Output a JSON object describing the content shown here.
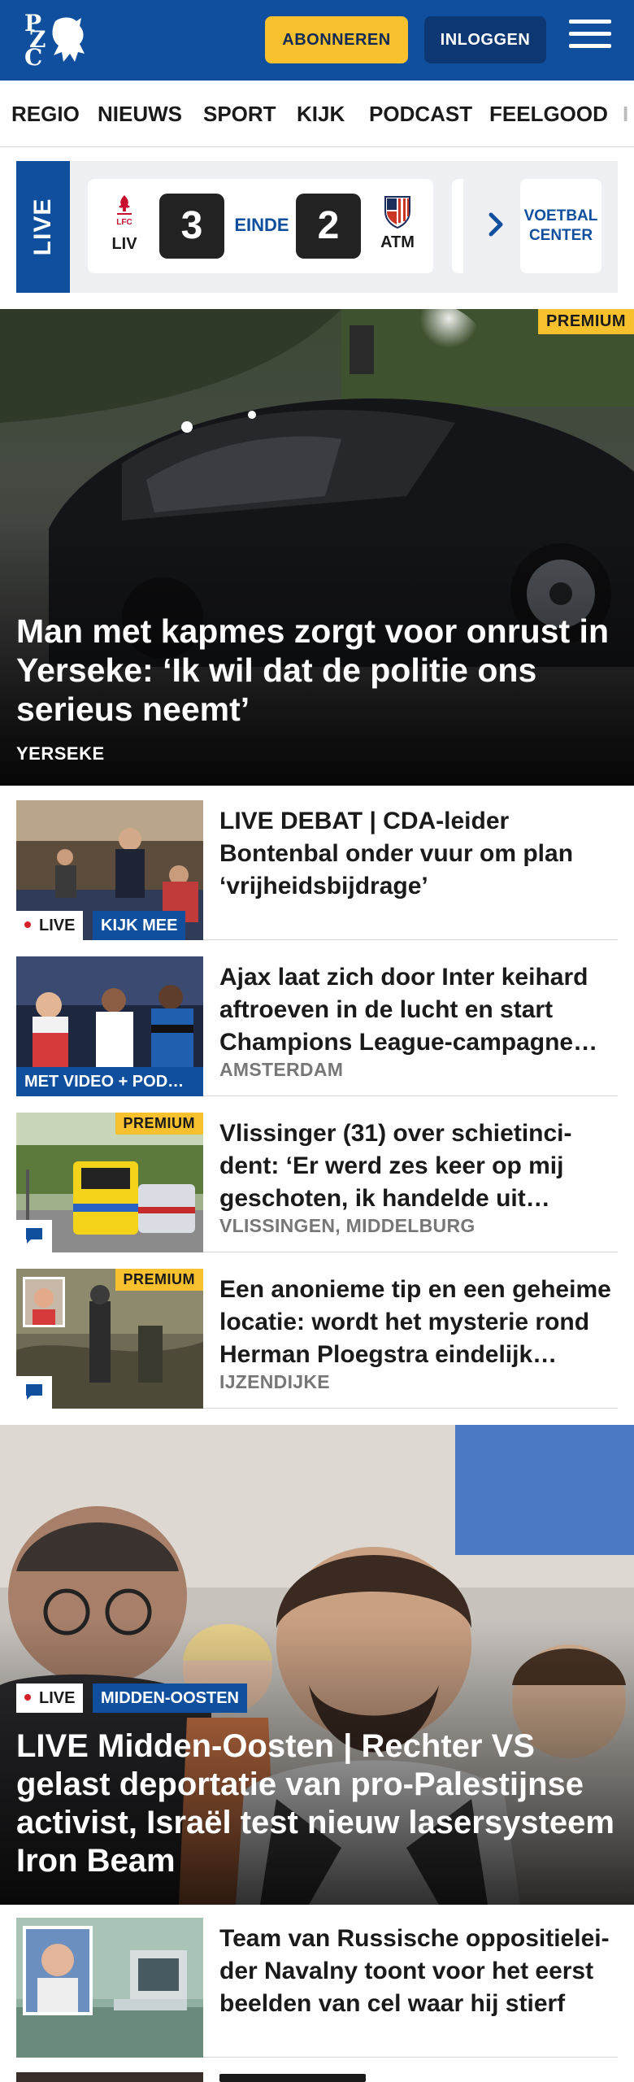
{
  "header": {
    "logo_text": "PZC",
    "subscribe_label": "ABONNEREN",
    "login_label": "INLOGGEN",
    "menu_icon": "hamburger-icon",
    "brand_color": "#0f4f9e",
    "accent_color": "#f7c12e"
  },
  "nav": {
    "items": [
      "REGIO",
      "NIEUWS",
      "SPORT",
      "KIJK",
      "PODCAST",
      "FEELGOOD",
      "I"
    ]
  },
  "live_strip": {
    "tab_label": "LIVE",
    "match": {
      "home_code": "LIV",
      "home_crest_text": "LFC",
      "home_score": "3",
      "status": "EINDE",
      "away_score": "2",
      "away_code": "ATM"
    },
    "voetbal_center_line1": "VOETBAL",
    "voetbal_center_line2": "CENTER"
  },
  "hero": {
    "badge": "PREMIUM",
    "title": "Man met kapmes zorgt voor onrust in Yerseke: ‘Ik wil dat de politie ons serieus neemt’",
    "location": "YERSEKE"
  },
  "articles": [
    {
      "title": "LIVE DEBAT | CDA-leider Bontenbal onder vuur om plan ‘vrijheidsbijdrage’",
      "live_label": "LIVE",
      "tag": "KIJK MEE"
    },
    {
      "title": "Ajax laat zich door Inter keihard aftroeven in de lucht en start Champions League-campagne…",
      "location": "AMSTERDAM",
      "tag": "MET VIDEO + POD…"
    },
    {
      "title": "Vlissinger (31) over schietinci­dent: ‘Er werd zes keer op mij geschoten, ik handelde uit…",
      "location": "VLISSINGEN, MIDDELBURG",
      "badge": "PREMIUM"
    },
    {
      "title": "Een anonieme tip en een geheime locatie: wordt het mysterie rond Herman Ploegstra eindelijk…",
      "location": "IJZENDIJKE",
      "badge": "PREMIUM"
    }
  ],
  "feature": {
    "live_label": "LIVE",
    "tag": "MIDDEN-OOSTEN",
    "title": "LIVE Midden-Oosten | Rechter VS gelast deportatie van pro-Palestijnse activist, Israël test nieuw lasersys­teem Iron Beam"
  },
  "article_bottom": {
    "title": "Team van Russische oppositielei­der Navalny toont voor het eerst beelden van cel waar hij stierf"
  }
}
